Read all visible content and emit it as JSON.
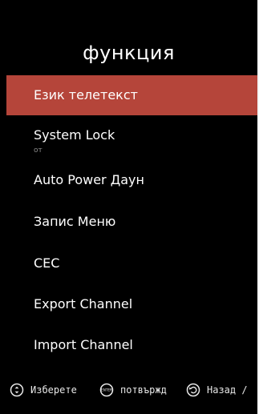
{
  "menu": {
    "title": "функция",
    "items": [
      {
        "label": "Език телетекст",
        "selected": true
      },
      {
        "label": "System Lock",
        "value": "от"
      },
      {
        "label": "Auto Power Даун"
      },
      {
        "label": "Запис Меню"
      },
      {
        "label": "CEC"
      },
      {
        "label": "Export Channel"
      },
      {
        "label": "Import Channel"
      }
    ],
    "highlight_color": "#b5453a"
  },
  "footer": {
    "select_icon": "up-down-arrows-icon",
    "select_label": "Изберете",
    "enter_icon": "enter-icon",
    "enter_badge": "ENTER",
    "confirm_label": "потвържд",
    "back_icon": "back-arrow-icon",
    "back_label": "Назад /"
  }
}
